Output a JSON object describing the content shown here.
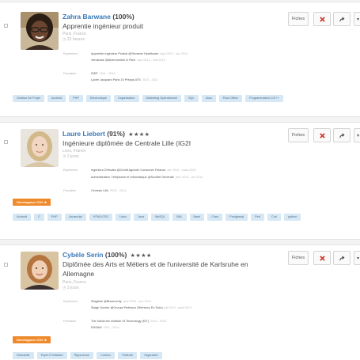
{
  "actions": {
    "fiches_label": "Fiches",
    "dropdown_glyph": "▾"
  },
  "candidates": [
    {
      "name": "Zahra Barwane",
      "percent": "(100%)",
      "stars": "",
      "title": "Apprentie ingénieur produit",
      "location": "Paris, France",
      "age": "◷ 23 heures",
      "experience_label": "Expérience",
      "experience": [
        {
          "text": "Apprentie Ingénieur Produit @Siemens Healthcare",
          "dates": "sept 2012 - avr 2014"
        },
        {
          "text": "Vendeuse @Abercrombie & Fitch",
          "dates": "sept 2012 - mai 2013"
        }
      ],
      "education_label": "Formation",
      "education": [
        {
          "text": "ISEP",
          "dates": "2011 - 2014"
        },
        {
          "text": "Lycée Jacquard Paris 19 Prépas ATS",
          "dates": "2010 - 2011"
        }
      ],
      "badge": "",
      "tags": [
        "Gestion De Projet",
        "Android",
        "PHP",
        "Electronique",
        "Organisation",
        "Marketing Opérationnel",
        "SQL",
        "Java",
        "Pack Office",
        "Programmation C/C++"
      ]
    },
    {
      "name": "Laure Liebert",
      "percent": "(91%)",
      "stars": "★★★★",
      "title": "Ingénieure diplômée de Centrale Lille (IG2I",
      "location": "Lens, France",
      "age": "◷ 2 jours",
      "experience_label": "Expérience",
      "experience": [
        {
          "text": "Ingénieur D'études @Crédit Agricole Consumer Finance",
          "dates": "avr 2014 - mars 2015"
        },
        {
          "text": "Administrateur Téléphonie et Informatique @Société Générale",
          "dates": "janv 2014 - avr 2014"
        }
      ],
      "education_label": "Formation",
      "education": [
        {
          "text": "Centrale Lille",
          "dates": "2010 - 2014"
        }
      ],
      "badge": "Développeur CSV ★",
      "tags": [
        "Android",
        "C",
        "PHP",
        "Javascript",
        "HTML/CSS",
        "Linux",
        "Java",
        "MySQL",
        "XML",
        "Bash",
        "Ciaro",
        "Postgresql",
        "Perl",
        "Curl",
        "python"
      ]
    },
    {
      "name": "Cybèle Serin",
      "percent": "(100%)",
      "stars": "★★★★",
      "title": "Diplômée des Arts et Métiers et de l'université de Karlsruhe en Allemagne",
      "location": "Paris, France",
      "age": "◷ 3 jours",
      "experience_label": "Expérience",
      "experience": [
        {
          "text": "Stagiaire @Biosenenty",
          "dates": "janv 2015 - juin 2015"
        },
        {
          "text": "Stage Ouvrier @Groupe Refresco (Refresco En Soto)",
          "dates": "juil 2014 - août 2014"
        }
      ],
      "education_label": "Formation",
      "education": [
        {
          "text": "The Karlsruhe Institute Of Technology (KIT)",
          "dates": "2014 - 2015"
        },
        {
          "text": "ENSAM",
          "dates": "2011 - 2014"
        }
      ],
      "badge": "Développeur CSV ★",
      "tags": [
        "Réactivité",
        "Esprit D'initiative",
        "Rigoureuse",
        "Curieux",
        "Patiente",
        "Organisée"
      ]
    }
  ]
}
